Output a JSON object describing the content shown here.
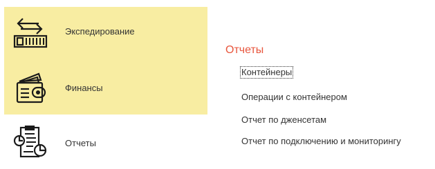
{
  "sidebar": {
    "items": [
      {
        "label": "Экспедирование",
        "icon": "shipping-container-icon",
        "active": true
      },
      {
        "label": "Финансы",
        "icon": "wallet-icon",
        "active": true
      },
      {
        "label": "Отчеты",
        "icon": "report-chart-icon",
        "active": false
      }
    ]
  },
  "panel": {
    "title": "Отчеты",
    "links": [
      {
        "label": "Контейнеры",
        "focused": true
      },
      {
        "label": "Операции с контейнером"
      },
      {
        "label": "Отчет по дженсетам"
      },
      {
        "label": "Отчет по подключению и мониторингу"
      }
    ]
  },
  "colors": {
    "active_bg": "#F8EDA2",
    "accent_title": "#E8553C",
    "text": "#333333"
  }
}
